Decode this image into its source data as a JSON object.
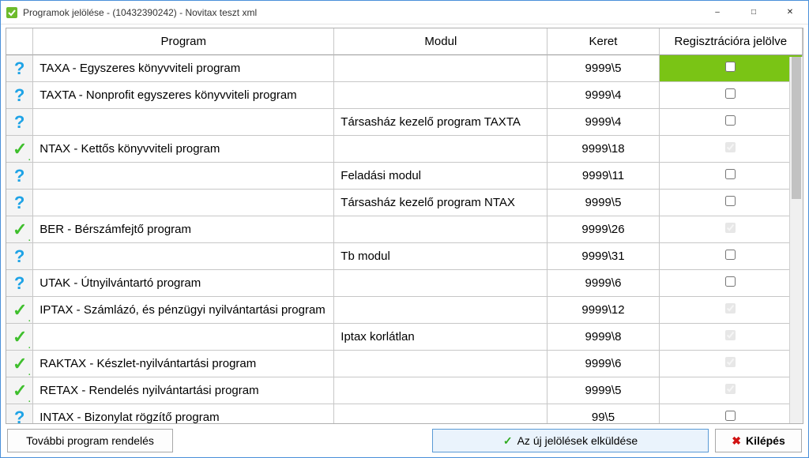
{
  "window": {
    "title": "Programok jelölése - (10432390242) - Novitax teszt xml"
  },
  "columns": {
    "program": "Program",
    "modul": "Modul",
    "keret": "Keret",
    "reg": "Regisztrációra jelölve"
  },
  "rows": [
    {
      "icon": "q",
      "program": "TAXA - Egyszeres könyvviteli program",
      "modul": "",
      "keret": "9999\\5",
      "checked": false,
      "disabled": false,
      "selected": true
    },
    {
      "icon": "q",
      "program": "TAXTA - Nonprofit egyszeres könyvviteli program",
      "modul": "",
      "keret": "9999\\4",
      "checked": false,
      "disabled": false,
      "selected": false
    },
    {
      "icon": "q",
      "program": "",
      "modul": "Társasház kezelő program TAXTA",
      "keret": "9999\\4",
      "checked": false,
      "disabled": false,
      "selected": false
    },
    {
      "icon": "check",
      "program": "NTAX - Kettős könyvviteli program",
      "modul": "",
      "keret": "9999\\18",
      "checked": true,
      "disabled": true,
      "selected": false
    },
    {
      "icon": "q",
      "program": "",
      "modul": "Feladási modul",
      "keret": "9999\\11",
      "checked": false,
      "disabled": false,
      "selected": false
    },
    {
      "icon": "q",
      "program": "",
      "modul": "Társasház kezelő program NTAX",
      "keret": "9999\\5",
      "checked": false,
      "disabled": false,
      "selected": false
    },
    {
      "icon": "check",
      "program": "BER - Bérszámfejtő program",
      "modul": "",
      "keret": "9999\\26",
      "checked": true,
      "disabled": true,
      "selected": false
    },
    {
      "icon": "q",
      "program": "",
      "modul": "Tb modul",
      "keret": "9999\\31",
      "checked": false,
      "disabled": false,
      "selected": false
    },
    {
      "icon": "q",
      "program": "UTAK - Útnyilvántartó program",
      "modul": "",
      "keret": "9999\\6",
      "checked": false,
      "disabled": false,
      "selected": false
    },
    {
      "icon": "check",
      "program": "IPTAX - Számlázó, és pénzügyi nyilvántartási program",
      "modul": "",
      "keret": "9999\\12",
      "checked": true,
      "disabled": true,
      "selected": false
    },
    {
      "icon": "check",
      "program": "",
      "modul": "Iptax korlátlan",
      "keret": "9999\\8",
      "checked": true,
      "disabled": true,
      "selected": false
    },
    {
      "icon": "check",
      "program": "RAKTAX - Készlet-nyilvántartási program",
      "modul": "",
      "keret": "9999\\6",
      "checked": true,
      "disabled": true,
      "selected": false
    },
    {
      "icon": "check",
      "program": "RETAX - Rendelés nyilvántartási program",
      "modul": "",
      "keret": "9999\\5",
      "checked": true,
      "disabled": true,
      "selected": false
    },
    {
      "icon": "q",
      "program": "INTAX - Bizonylat rögzítő program",
      "modul": "",
      "keret": "99\\5",
      "checked": false,
      "disabled": false,
      "selected": false
    }
  ],
  "footer": {
    "order": "További program rendelés",
    "send": "Az új jelölések elküldése",
    "exit": "Kilépés"
  }
}
